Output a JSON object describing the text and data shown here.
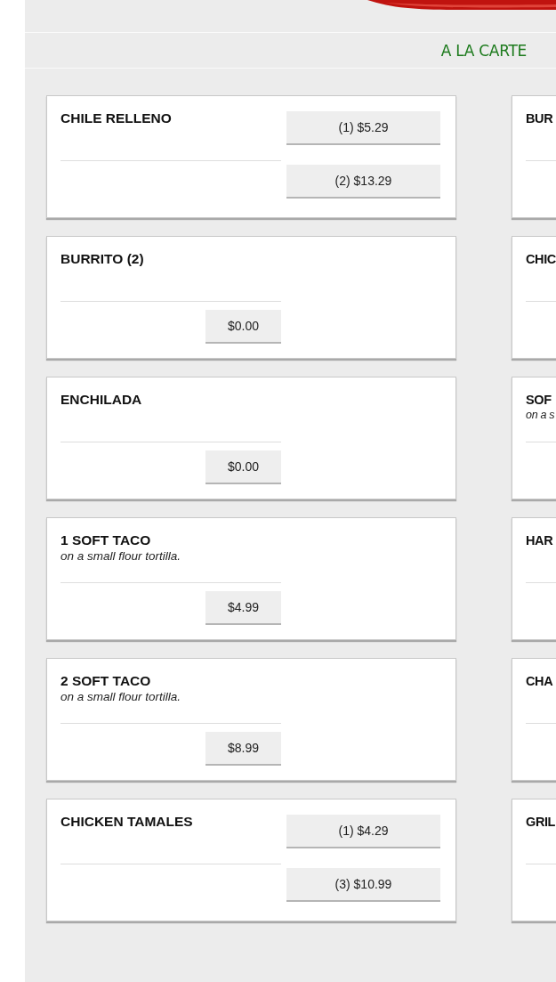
{
  "section_title": "A LA CARTE",
  "left_items": [
    {
      "kind": "multi",
      "name": "CHILE RELLENO",
      "prices": [
        "(1) $5.29",
        "(2) $13.29"
      ]
    },
    {
      "kind": "single",
      "name": "BURRITO (2)",
      "prices": [
        "$0.00"
      ]
    },
    {
      "kind": "single",
      "name": "ENCHILADA",
      "prices": [
        "$0.00"
      ]
    },
    {
      "kind": "single",
      "name": "1 SOFT TACO",
      "description": "on a small flour tortilla.",
      "prices": [
        "$4.99"
      ]
    },
    {
      "kind": "single",
      "name": "2 SOFT TACO",
      "description": "on a small flour tortilla.",
      "prices": [
        "$8.99"
      ]
    },
    {
      "kind": "multi",
      "name": "CHICKEN TAMALES",
      "prices": [
        "(1) $4.29",
        "(3) $10.99"
      ]
    }
  ],
  "right_items": [
    {
      "name": "BUR"
    },
    {
      "name": "CHIC"
    },
    {
      "name": "SOF",
      "description": "on a s"
    },
    {
      "name": "HAR"
    },
    {
      "name": "CHA"
    },
    {
      "name": "GRIL"
    }
  ]
}
